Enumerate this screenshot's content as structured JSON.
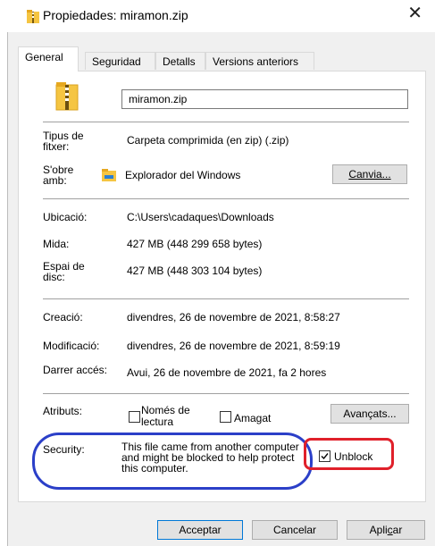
{
  "window": {
    "title": "Propiedades: miramon.zip"
  },
  "tabs": [
    {
      "label": "General"
    },
    {
      "label": "Seguridad",
      "underline": "g"
    },
    {
      "label": "Detalls"
    },
    {
      "label": "Versions anteriors"
    }
  ],
  "file": {
    "name": "miramon.zip"
  },
  "fields": {
    "type_label": "Tipus de fitxer:",
    "type_value": "Carpeta comprimida (en zip) (.zip)",
    "opens_label": "S'obre amb:",
    "opens_value": "Explorador del Windows",
    "change_button": "Canvia...",
    "location_label": "Ubicació:",
    "location_value": "C:\\Users\\cadaques\\Downloads",
    "size_label": "Mida:",
    "size_value": "427 MB (448 299 658 bytes)",
    "disk_label": "Espai de disc:",
    "disk_value": "427 MB (448 303 104 bytes)",
    "created_label": "Creació:",
    "created_value": "divendres, 26 de novembre de 2021, 8:58:27",
    "modified_label": "Modificació:",
    "modified_value": "divendres, 26 de novembre de 2021, 8:59:19",
    "accessed_label": "Darrer accés:",
    "accessed_value": "Avui, 26 de novembre de 2021, fa 2 hores",
    "attributes_label": "Atributs:",
    "readonly_label": "Només de lectura",
    "hidden_label": "Amagat",
    "advanced_button": "Avançats...",
    "security_label": "Security:",
    "security_text": "This file came from another computer and might be blocked to help protect this computer.",
    "unblock_label": "Unblock",
    "unblock_checked": true
  },
  "footer": {
    "ok": "Acceptar",
    "cancel": "Cancelar",
    "apply": "Aplicar"
  },
  "colors": {
    "annotation_blue": "#2b3fc8",
    "annotation_red": "#e0202a",
    "focus_blue": "#0078d7",
    "folder_yellow": "#f5c542"
  }
}
